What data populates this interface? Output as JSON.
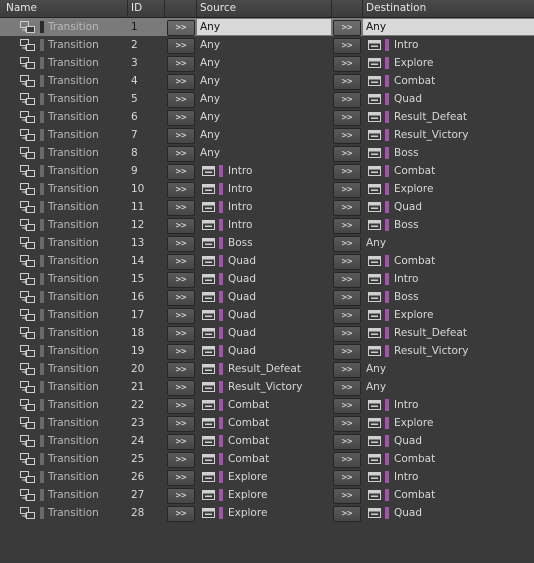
{
  "header": {
    "name": "Name",
    "id": "ID",
    "source": "Source",
    "destination": "Destination"
  },
  "button_label": ">>",
  "colors": {
    "state_accent": "#a154a8",
    "selection": "#7a7a7a"
  },
  "rows": [
    {
      "name": "Transition",
      "id": "1",
      "source": "Any",
      "destination": "Any",
      "selected": true
    },
    {
      "name": "Transition",
      "id": "2",
      "source": "Any",
      "destination": "Intro"
    },
    {
      "name": "Transition",
      "id": "3",
      "source": "Any",
      "destination": "Explore"
    },
    {
      "name": "Transition",
      "id": "4",
      "source": "Any",
      "destination": "Combat"
    },
    {
      "name": "Transition",
      "id": "5",
      "source": "Any",
      "destination": "Quad"
    },
    {
      "name": "Transition",
      "id": "6",
      "source": "Any",
      "destination": "Result_Defeat"
    },
    {
      "name": "Transition",
      "id": "7",
      "source": "Any",
      "destination": "Result_Victory"
    },
    {
      "name": "Transition",
      "id": "8",
      "source": "Any",
      "destination": "Boss"
    },
    {
      "name": "Transition",
      "id": "9",
      "source": "Intro",
      "destination": "Combat"
    },
    {
      "name": "Transition",
      "id": "10",
      "source": "Intro",
      "destination": "Explore"
    },
    {
      "name": "Transition",
      "id": "11",
      "source": "Intro",
      "destination": "Quad"
    },
    {
      "name": "Transition",
      "id": "12",
      "source": "Intro",
      "destination": "Boss"
    },
    {
      "name": "Transition",
      "id": "13",
      "source": "Boss",
      "destination": "Any"
    },
    {
      "name": "Transition",
      "id": "14",
      "source": "Quad",
      "destination": "Combat"
    },
    {
      "name": "Transition",
      "id": "15",
      "source": "Quad",
      "destination": "Intro"
    },
    {
      "name": "Transition",
      "id": "16",
      "source": "Quad",
      "destination": "Boss"
    },
    {
      "name": "Transition",
      "id": "17",
      "source": "Quad",
      "destination": "Explore"
    },
    {
      "name": "Transition",
      "id": "18",
      "source": "Quad",
      "destination": "Result_Defeat"
    },
    {
      "name": "Transition",
      "id": "19",
      "source": "Quad",
      "destination": "Result_Victory"
    },
    {
      "name": "Transition",
      "id": "20",
      "source": "Result_Defeat",
      "destination": "Any"
    },
    {
      "name": "Transition",
      "id": "21",
      "source": "Result_Victory",
      "destination": "Any"
    },
    {
      "name": "Transition",
      "id": "22",
      "source": "Combat",
      "destination": "Intro"
    },
    {
      "name": "Transition",
      "id": "23",
      "source": "Combat",
      "destination": "Explore"
    },
    {
      "name": "Transition",
      "id": "24",
      "source": "Combat",
      "destination": "Quad"
    },
    {
      "name": "Transition",
      "id": "25",
      "source": "Combat",
      "destination": "Combat"
    },
    {
      "name": "Transition",
      "id": "26",
      "source": "Explore",
      "destination": "Intro"
    },
    {
      "name": "Transition",
      "id": "27",
      "source": "Explore",
      "destination": "Combat"
    },
    {
      "name": "Transition",
      "id": "28",
      "source": "Explore",
      "destination": "Quad"
    }
  ]
}
